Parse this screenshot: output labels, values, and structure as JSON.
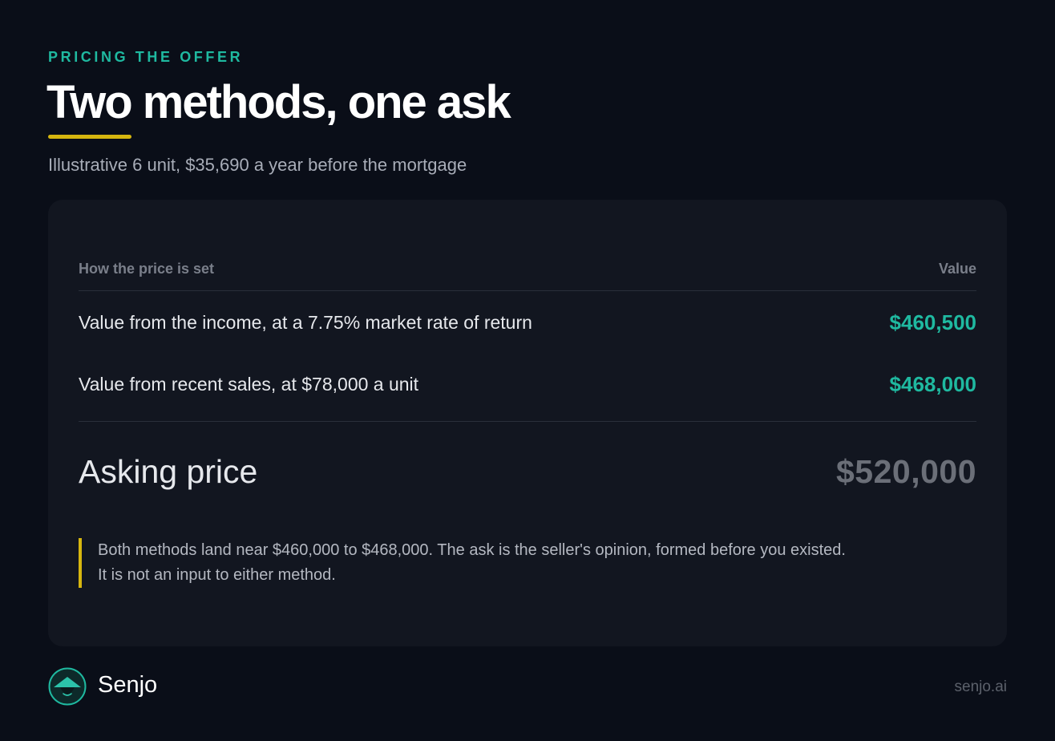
{
  "header": {
    "eyebrow": "PRICING THE OFFER",
    "title": "Two methods, one ask",
    "subtitle": "Illustrative 6 unit, $35,690 a year before the mortgage"
  },
  "table": {
    "column_method": "How the price is set",
    "column_value": "Value",
    "rows": [
      {
        "label": "Value from the income, at a 7.75% market rate of return",
        "value": "$460,500"
      },
      {
        "label": "Value from recent sales, at $78,000 a unit",
        "value": "$468,000"
      }
    ],
    "asking": {
      "label": "Asking price",
      "value": "$520,000"
    }
  },
  "note": {
    "line1": "Both methods land near $460,000 to $468,000. The ask is the seller's opinion, formed before you existed.",
    "line2": "It is not an input to either method."
  },
  "footer": {
    "brand": "Senjo",
    "site": "senjo.ai",
    "logo_icon": "senjo-conical-hat-logo-icon"
  },
  "colors": {
    "background": "#0a0e18",
    "card": "#121620",
    "accent_teal": "#1fb9a0",
    "accent_gold": "#d6b60f",
    "muted_value": "#6b6f78"
  }
}
